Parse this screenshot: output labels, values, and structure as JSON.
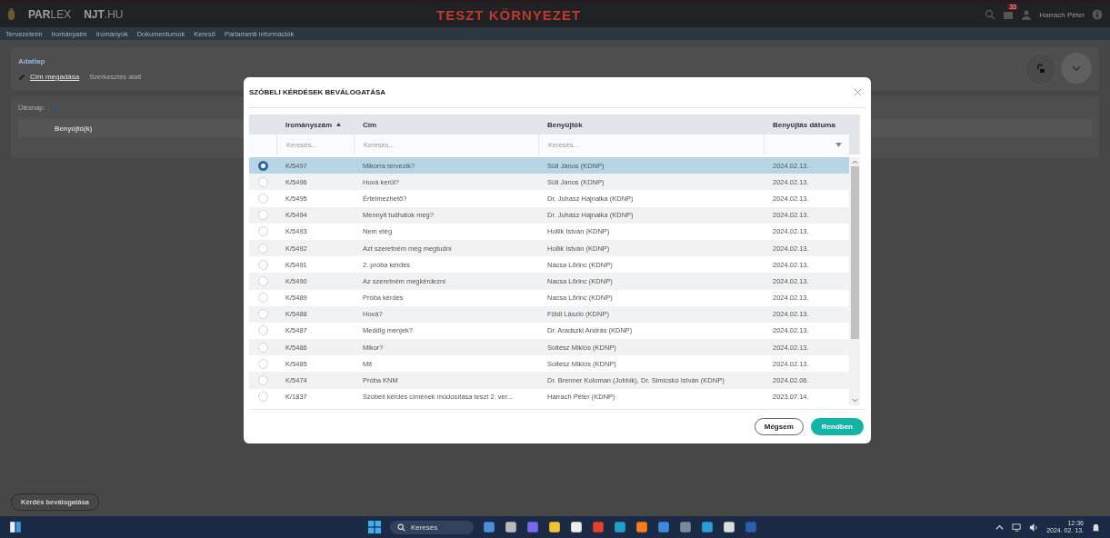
{
  "header": {
    "brand_bold": "PAR",
    "brand_light": "LEX",
    "link_bold": "NJT",
    "link_light": ".HU",
    "environment": "TESZT KÖRNYEZET",
    "notification_count": "33",
    "user": "Harrach Péter"
  },
  "nav": [
    "Tervezeteim",
    "Irományaim",
    "Irományok",
    "Dokumentumok",
    "Kereső",
    "Parlamenti információk"
  ],
  "page": {
    "section": "Adatlap",
    "step": "Cím megadása",
    "status": "Szerkesztés alatt",
    "session_label": "Ülésnap:",
    "column": "Benyújtó(k)",
    "action_button": "Kérdés beválogatása"
  },
  "dialog": {
    "title": "SZÓBELI KÉRDÉSEK BEVÁLOGATÁSA",
    "columns": [
      {
        "label": "Irományszám",
        "sorted": true
      },
      {
        "label": "Cím",
        "sorted": false
      },
      {
        "label": "Benyújtók",
        "sorted": false
      },
      {
        "label": "Benyújtás dátuma",
        "sorted": false
      }
    ],
    "filters": [
      {
        "kind": "text",
        "placeholder": "Keresés..."
      },
      {
        "kind": "text",
        "placeholder": "Keresés..."
      },
      {
        "kind": "text",
        "placeholder": "Keresés..."
      },
      {
        "kind": "dropdown"
      }
    ],
    "rows": [
      {
        "number": "K/5497",
        "title": "Mikorra tervezik?",
        "submitters": "Süli János (KDNP)",
        "date": "2024.02.13.",
        "selected": true
      },
      {
        "number": "K/5496",
        "title": "Hová kerül?",
        "submitters": "Süli János (KDNP)",
        "date": "2024.02.13.",
        "selected": false
      },
      {
        "number": "K/5495",
        "title": "Értelmezhető?",
        "submitters": "Dr. Juhász Hajnalka (KDNP)",
        "date": "2024.02.13.",
        "selected": false
      },
      {
        "number": "K/5494",
        "title": "Mennyit tudhatok meg?",
        "submitters": "Dr. Juhász Hajnalka (KDNP)",
        "date": "2024.02.13.",
        "selected": false
      },
      {
        "number": "K/5493",
        "title": "Nem elég",
        "submitters": "Hollik István (KDNP)",
        "date": "2024.02.13.",
        "selected": false
      },
      {
        "number": "K/5492",
        "title": "Azt szeretném még megtudni",
        "submitters": "Hollik István (KDNP)",
        "date": "2024.02.13.",
        "selected": false
      },
      {
        "number": "K/5491",
        "title": "2. próba kérdés",
        "submitters": "Nacsa Lőrinc (KDNP)",
        "date": "2024.02.13.",
        "selected": false
      },
      {
        "number": "K/5490",
        "title": "Az szeretném megkérdezni",
        "submitters": "Nacsa Lőrinc (KDNP)",
        "date": "2024.02.13.",
        "selected": false
      },
      {
        "number": "K/5489",
        "title": "Próba kérdés",
        "submitters": "Nacsa Lőrinc (KDNP)",
        "date": "2024.02.13.",
        "selected": false
      },
      {
        "number": "K/5488",
        "title": "Hová?",
        "submitters": "Földi László (KDNP)",
        "date": "2024.02.13.",
        "selected": false
      },
      {
        "number": "K/5487",
        "title": "Meddig menjek?",
        "submitters": "Dr. Aradszki András (KDNP)",
        "date": "2024.02.13.",
        "selected": false
      },
      {
        "number": "K/5486",
        "title": "Mikor?",
        "submitters": "Soltész Miklós (KDNP)",
        "date": "2024.02.13.",
        "selected": false
      },
      {
        "number": "K/5485",
        "title": "Mit",
        "submitters": "Soltész Miklós (KDNP)",
        "date": "2024.02.13.",
        "selected": false
      },
      {
        "number": "K/5474",
        "title": "Próba KNM",
        "submitters": "Dr. Brenner Koloman (Jobbik), Dr. Simicskó István (KDNP)",
        "date": "2024.02.06.",
        "selected": false
      },
      {
        "number": "K/1837",
        "title": "Szóbeli kérdés címének módosítása teszt 2. ver...",
        "submitters": "Harrach Péter (KDNP)",
        "date": "2023.07.14.",
        "selected": false
      }
    ],
    "cancel_button": "Mégsem",
    "ok_button": "Rendben"
  },
  "taskbar": {
    "search": "Keresés",
    "time": "12:36",
    "date": "2024. 02. 13."
  }
}
